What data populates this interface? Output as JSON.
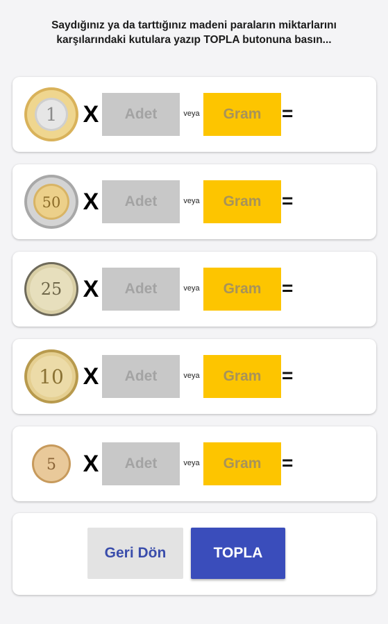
{
  "header": {
    "instruction_line1": "Saydığınız ya da tarttığınız madeni paraların miktarlarını",
    "instruction_line2": "karşılarındaki kutulara yazıp TOPLA butonuna basın..."
  },
  "coins": [
    {
      "label": "1",
      "icon": "coin-1-lira-icon"
    },
    {
      "label": "50",
      "icon": "coin-50-kurus-icon"
    },
    {
      "label": "25",
      "icon": "coin-25-kurus-icon"
    },
    {
      "label": "10",
      "icon": "coin-10-kurus-icon"
    },
    {
      "label": "5",
      "icon": "coin-5-kurus-icon"
    }
  ],
  "row": {
    "times": "X",
    "count_placeholder": "Adet",
    "or": "veya",
    "gram_placeholder": "Gram",
    "equals": "="
  },
  "buttons": {
    "back_label": "Geri Dön",
    "sum_label": "TOPLA"
  },
  "colors": {
    "count_box": "#c8c8c8",
    "gram_box": "#fdc500",
    "primary_button": "#3a4dbb",
    "secondary_button": "#e3e3e3"
  }
}
